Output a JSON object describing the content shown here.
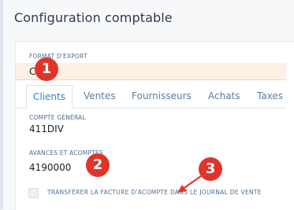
{
  "panel": {
    "title": "Configuration comptable"
  },
  "export_format": {
    "label": "FORMAT D'EXPORT",
    "value": "C"
  },
  "tabs": [
    {
      "label": "Clients",
      "active": true
    },
    {
      "label": "Ventes",
      "active": false
    },
    {
      "label": "Fournisseurs",
      "active": false
    },
    {
      "label": "Achats",
      "active": false
    },
    {
      "label": "Taxes",
      "active": false
    }
  ],
  "general_account": {
    "label": "COMPTE GÉNÉRAL",
    "value": "411DIV"
  },
  "advances": {
    "label": "AVANCES ET ACOMPTES",
    "value": "4190000"
  },
  "transfer_checkbox": {
    "label": "TRANSFÉRER LA FACTURE D'ACOMPTE DANS LE JOURNAL DE VENTE",
    "checked": false
  },
  "annotations": [
    {
      "number": "1",
      "color": "#e0342a"
    },
    {
      "number": "2",
      "color": "#e0342a"
    },
    {
      "number": "3",
      "color": "#e0342a"
    }
  ]
}
